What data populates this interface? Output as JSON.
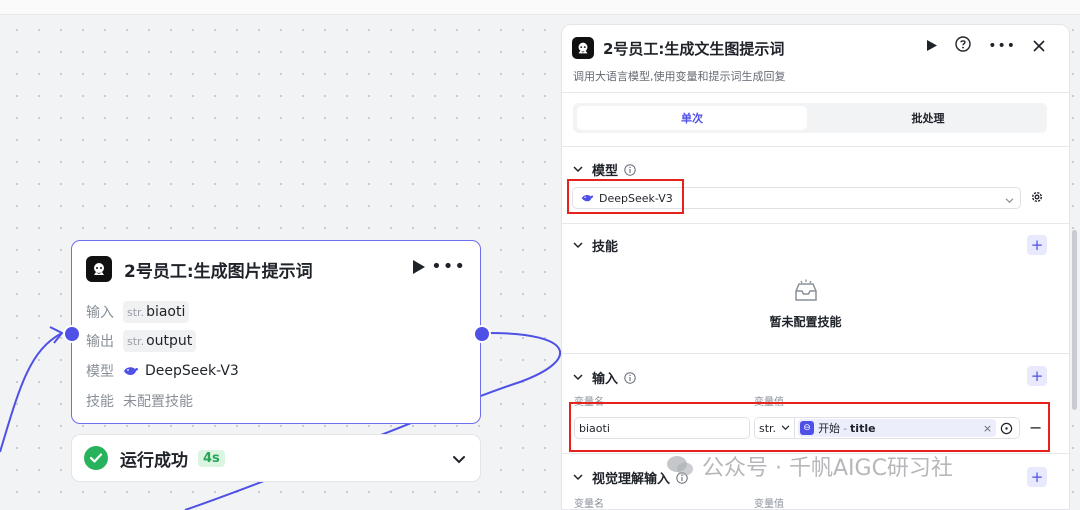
{
  "node": {
    "title": "2号员工:生成图片提示词",
    "rows": [
      {
        "label": "输入",
        "type": "str.",
        "value": "biaoti"
      },
      {
        "label": "输出",
        "type": "str.",
        "value": "output"
      },
      {
        "label": "模型",
        "value": "DeepSeek-V3"
      },
      {
        "label": "技能",
        "value": "未配置技能"
      }
    ]
  },
  "run_status": {
    "text": "运行成功",
    "duration": "4s"
  },
  "panel": {
    "title": "2号员工:生成文生图提示词",
    "description": "调用大语言模型,使用变量和提示词生成回复",
    "tabs": [
      {
        "label": "单次",
        "active": true
      },
      {
        "label": "批处理",
        "active": false
      }
    ],
    "model_section": {
      "title": "模型",
      "selected": "DeepSeek-V3"
    },
    "skills_section": {
      "title": "技能",
      "empty_text": "暂未配置技能"
    },
    "input_section": {
      "title": "输入",
      "col_name": "变量名",
      "col_value": "变量值",
      "row": {
        "name": "biaoti",
        "type": "str.",
        "ref_source": "开始",
        "ref_separator": "-",
        "ref_field": "title"
      }
    },
    "vision_section": {
      "title": "视觉理解输入",
      "col_name": "变量名",
      "col_value": "变量值"
    }
  },
  "watermark": {
    "text": "公众号 · 千帆AIGC研习社"
  },
  "colors": {
    "accent": "#4e50e6",
    "success": "#27b35b",
    "highlight_box": "#e5221c"
  }
}
